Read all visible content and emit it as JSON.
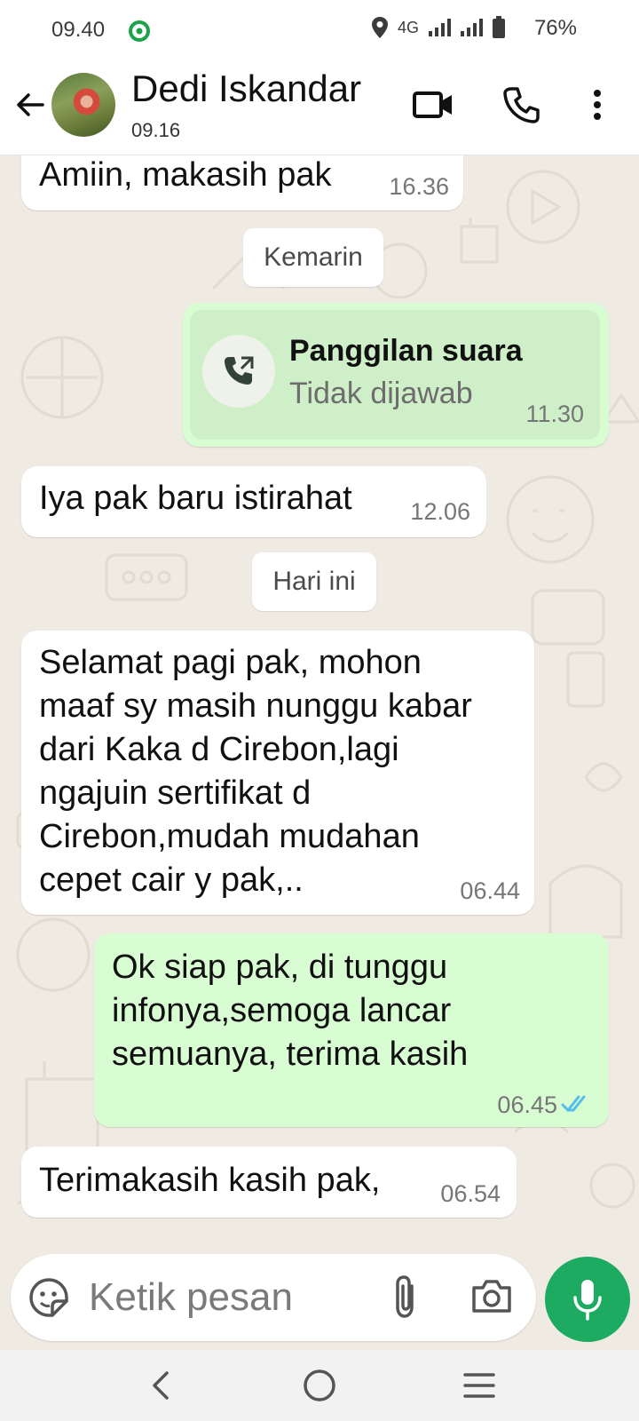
{
  "status_bar": {
    "time": "09.40",
    "network": "4G",
    "battery": "76%"
  },
  "header": {
    "contact_name": "Dedi Iskandar",
    "subtitle": "09.16",
    "icons": [
      "back-arrow-icon",
      "video-call-icon",
      "voice-call-icon",
      "more-menu-icon"
    ]
  },
  "messages": [
    {
      "type": "incoming",
      "text": "Amiin, makasih pak",
      "time": "16.36"
    },
    {
      "type": "date",
      "text": "Kemarin"
    },
    {
      "type": "outgoing-call",
      "title": "Panggilan suara",
      "status": "Tidak dijawab",
      "time": "11.30"
    },
    {
      "type": "incoming",
      "text": "Iya pak baru istirahat",
      "time": "12.06"
    },
    {
      "type": "date",
      "text": "Hari ini"
    },
    {
      "type": "incoming",
      "text": "Selamat pagi pak, mohon\nmaaf sy masih nunggu kabar\ndari Kaka d Cirebon,lagi\nngajuin sertifikat d\nCirebon,mudah mudahan\ncepet cair y pak,..",
      "time": "06.44"
    },
    {
      "type": "outgoing",
      "text": "Ok siap pak, di tunggu\ninfonya,semoga lancar\nsemuanya, terima kasih",
      "time": "06.45",
      "read": true
    },
    {
      "type": "incoming",
      "text": "Terimakasih kasih pak,",
      "time": "06.54"
    }
  ],
  "composer": {
    "placeholder": "Ketik pesan"
  },
  "colors": {
    "chat_background": "#efeae2",
    "outgoing_bubble": "#d9fdd3",
    "incoming_bubble": "#ffffff",
    "accent_green": "#1daa61",
    "read_tick_blue": "#53bdeb"
  }
}
